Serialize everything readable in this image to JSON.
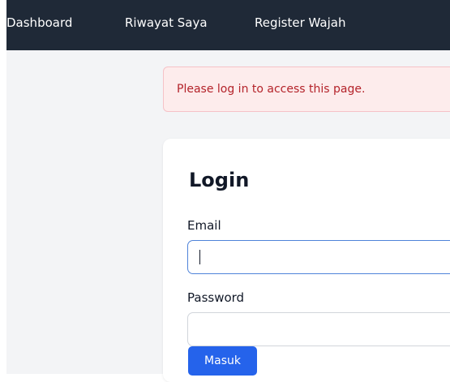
{
  "nav": {
    "dashboard": "Dashboard",
    "riwayat": "Riwayat Saya",
    "register": "Register Wajah"
  },
  "alert": {
    "message": "Please log in to access this page."
  },
  "login": {
    "title": "Login",
    "email_label": "Email",
    "email_value": "",
    "password_label": "Password",
    "password_value": "",
    "submit_label": "Masuk"
  },
  "colors": {
    "navbar": "#1f2937",
    "alert_bg": "#fdecec",
    "alert_text": "#b4232a",
    "button": "#2563eb",
    "focus_border": "#4f83d9"
  }
}
